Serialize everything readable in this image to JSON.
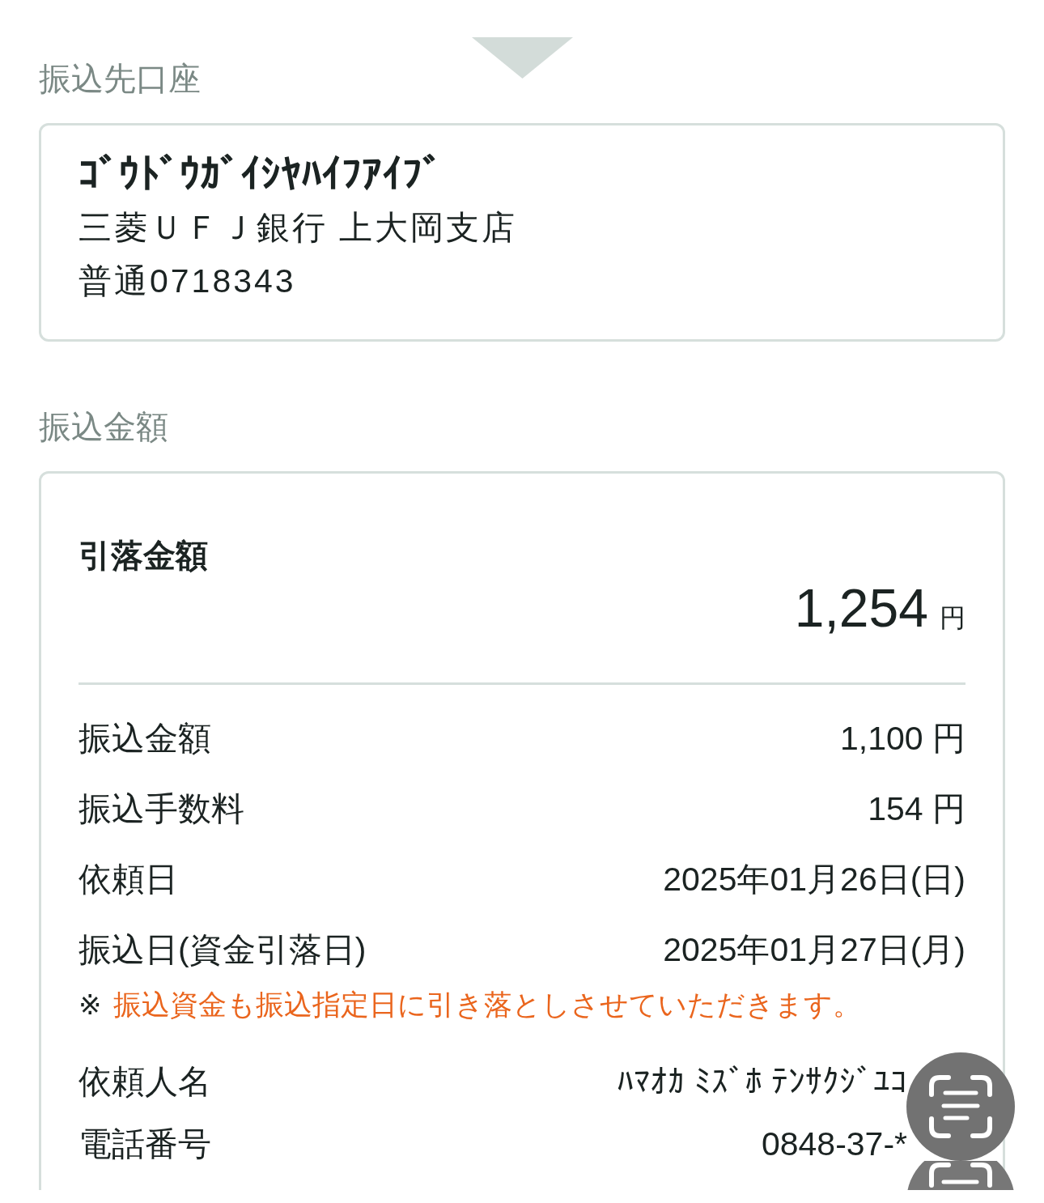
{
  "payee": {
    "title": "振込先口座",
    "account_name": "ｺﾞｳﾄﾞｳｶﾞｲｼﾔﾊｲﾌｱｲﾌﾞ",
    "bank_branch": "三菱ＵＦＪ銀行 上大岡支店",
    "account": "普通0718343"
  },
  "transfer": {
    "title": "振込金額",
    "total": {
      "label": "引落金額",
      "amount": "1,254",
      "unit": "円"
    },
    "details": [
      {
        "label": "振込金額",
        "value": "1,100 円"
      },
      {
        "label": "振込手数料",
        "value": "154 円"
      },
      {
        "label": "依頼日",
        "value": "2025年01月26日(日)"
      },
      {
        "label": "振込日(資金引落日)",
        "value": "2025年01月27日(月)"
      }
    ],
    "note": {
      "mark": "※",
      "text": "振込資金も振込指定日に引き落としさせていただきます。"
    },
    "requester": [
      {
        "label": "依頼人名",
        "value": "ﾊﾏｵｶ ﾐｽﾞﾎ ﾃﾝｻｸｼﾞﾕｺ"
      },
      {
        "label": "電話番号",
        "value": "0848-37-*"
      }
    ]
  }
}
